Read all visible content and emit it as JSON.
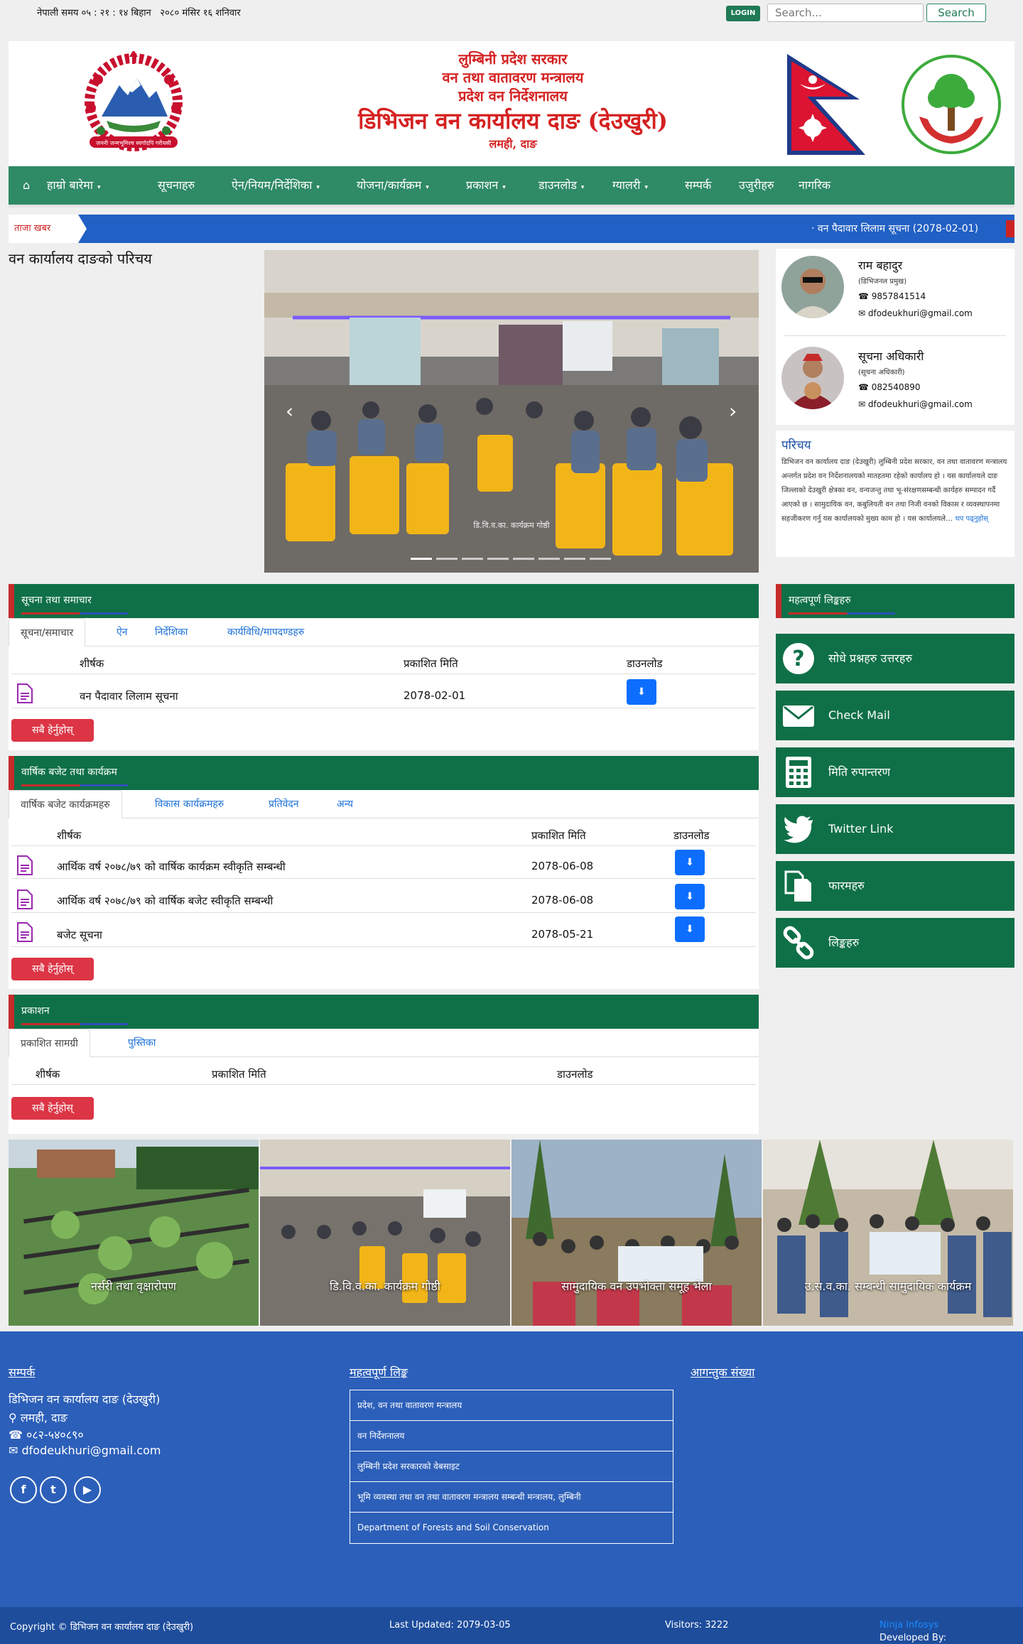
{
  "topbar": {
    "time_label": "नेपाली समय ०५ : २१ : १४ बिहान",
    "date_label": "२०८० मंसिर १६ शनिवार",
    "login": "LOGIN",
    "search_placeholder": "Search...",
    "search_button": "Search"
  },
  "header": {
    "line1": "लुम्बिनी प्रदेश सरकार",
    "line2": "वन तथा वातावरण मन्त्रालय",
    "line3": "प्रदेश वन निर्देशनालय",
    "line4": "डिभिजन वन कार्यालय दाङ (देउखुरी)",
    "line5": "लमही, दाङ",
    "logo_text": "हरा रोपौं वन जोगाऔं"
  },
  "nav": {
    "home_icon": "home-icon",
    "items": [
      {
        "label": "हाम्रो बारेमा",
        "dropdown": true
      },
      {
        "label": "सूचनाहरु",
        "dropdown": false
      },
      {
        "label": "ऐन/नियम/निर्देशिका",
        "dropdown": true
      },
      {
        "label": "योजना/कार्यक्रम",
        "dropdown": true
      },
      {
        "label": "प्रकाशन",
        "dropdown": true
      },
      {
        "label": "डाउनलोड",
        "dropdown": true
      },
      {
        "label": "ग्यालरी",
        "dropdown": true
      },
      {
        "label": "सम्पर्क",
        "dropdown": false
      },
      {
        "label": "उजुरीहरु",
        "dropdown": false
      },
      {
        "label": "नागरिक",
        "dropdown": false
      }
    ]
  },
  "ticker": {
    "label": "ताजा खबर",
    "text": "·   वन पैदावार लिलाम सूचना (2078-02-01)"
  },
  "main_title": "वन कार्यालय दाङको परिचय",
  "slider": {
    "caption": "डि.वि.व.का. कार्यक्रम गोष्ठी",
    "dot_count": 8,
    "active_dot": 0
  },
  "officers": [
    {
      "name": "राम बहादुर",
      "role": "(डिभिजनल प्रमुख)",
      "phone": "9857841514",
      "email": "dfodeukhuri@gmail.com"
    },
    {
      "name": "सूचना अधिकारी",
      "role": "(सूचना अधिकारी)",
      "phone": "082540890",
      "email": "dfodeukhuri@gmail.com"
    }
  ],
  "about": {
    "title": "परिचय",
    "body": "डिभिजन वन कार्यालय दाङ (देउखुरी) लुम्बिनी प्रदेश सरकार, वन तथा वातावरण मन्त्रालय अन्तर्गत प्रदेश वन निर्देशनालयको मातहतमा रहेको कार्यालय हो । यस कार्यालयले दाङ जिल्लाको देउखुरी क्षेत्रका वन, वन्यजन्तु तथा भू-संरक्षणसम्बन्धी कार्यहरु सम्पादन गर्दै आएको छ । सामुदायिक वन, कबुलियती वन तथा निजी वनको विकास र व्यवस्थापनमा सहजीकरण गर्नु यस कार्यालयको मुख्य काम हो । यस कार्यालयले…",
    "read_more": "थप पढ्नुहोस्"
  },
  "panel1": {
    "title": "सूचना तथा समाचार",
    "tabs": [
      "सूचना/समाचार",
      "ऐन",
      "निर्देशिका",
      "कार्यविधि/मापदण्डहरु"
    ],
    "headers": [
      "शीर्षक",
      "प्रकाशित मिति",
      "डाउनलोड"
    ],
    "rows": [
      {
        "title": "वन पैदावार लिलाम सूचना",
        "date": "2078-02-01"
      }
    ],
    "all_button": "सबै हेर्नुहोस्"
  },
  "panel2": {
    "title": "वार्षिक बजेट तथा कार्यक्रम",
    "tabs": [
      "वार्षिक बजेट कार्यक्रमहरु",
      "विकास कार्यक्रमहरु",
      "प्रतिवेदन",
      "अन्य"
    ],
    "headers": [
      "शीर्षक",
      "प्रकाशित मिति",
      "डाउनलोड"
    ],
    "rows": [
      {
        "title": "आर्थिक वर्ष २०७८/७९ को वार्षिक कार्यक्रम स्वीकृति सम्बन्धी",
        "date": "2078-06-08"
      },
      {
        "title": "आर्थिक वर्ष २०७८/७९ को वार्षिक बजेट स्वीकृति सम्बन्धी",
        "date": "2078-06-08"
      },
      {
        "title": "बजेट सूचना",
        "date": "2078-05-21"
      }
    ],
    "all_button": "सबै हेर्नुहोस्"
  },
  "panel3": {
    "title": "प्रकाशन",
    "tabs": [
      "प्रकाशित सामग्री",
      "पुस्तिका"
    ],
    "headers": [
      "शीर्षक",
      "प्रकाशित मिति",
      "डाउनलोड"
    ],
    "all_button": "सबै हेर्नुहोस्"
  },
  "side": {
    "title": "महत्वपूर्ण लिङ्कहरु",
    "links": [
      {
        "label": "सोधे प्रश्नहरु उत्तरहरु",
        "icon": "question-icon"
      },
      {
        "label": "Check Mail",
        "icon": "mail-icon"
      },
      {
        "label": "मिति रुपान्तरण",
        "icon": "calculator-icon"
      },
      {
        "label": "Twitter Link",
        "icon": "twitter-icon"
      },
      {
        "label": "फारमहरु",
        "icon": "copy-icon"
      },
      {
        "label": "लिङ्कहरु",
        "icon": "link-icon"
      }
    ]
  },
  "gallery": [
    {
      "caption": "नर्सरी तथा वृक्षारोपण"
    },
    {
      "caption": "डि.वि.व.का. कार्यक्रम गोष्ठी"
    },
    {
      "caption": "सामुदायिक वन उपभोक्ता समूह भेला"
    },
    {
      "caption": "उ.स.व.का. सम्बन्धी सामुदायिक कार्यक्रम"
    }
  ],
  "footer": {
    "contact_title": "सम्पर्क",
    "office": "डिभिजन वन कार्यालय दाङ (देउखुरी)",
    "address": "लमही, दाङ",
    "phone": "०८२-५४०८९०",
    "email": "dfodeukhuri@gmail.com",
    "links_title": "महत्वपूर्ण लिङ्क",
    "links": [
      "प्रदेश, वन तथा वातावरण मन्त्रालय",
      "वन निर्देशनालय",
      "लुम्बिनी प्रदेश सरकारको वेबसाइट",
      "भूमि व्यवस्था तथा वन तथा वातावरण मन्त्रालय सम्बन्धी मन्त्रालय, लुम्बिनी",
      "Department of Forests and Soil Conservation"
    ],
    "visitor_title": "आगन्तुक संख्या",
    "social": [
      "f",
      "t",
      "▶"
    ]
  },
  "bottom": {
    "copyright": "Copyright © डिभिजन वन कार्यालय दाङ (देउखुरी)",
    "updated": "Last Updated: 2079-03-05",
    "visitors": "Visitors: 3222",
    "developed_label": "Developed By:",
    "developer": "Ninja Infosys"
  },
  "colors": {
    "nav_green": "#2f8a66",
    "panel_green": "#0f7047",
    "accent_red": "#c62b2b",
    "footer_blue": "#2c5fb9",
    "ticker_blue": "#2160c4",
    "button_red": "#dc3545",
    "button_blue": "#0d6efd"
  }
}
